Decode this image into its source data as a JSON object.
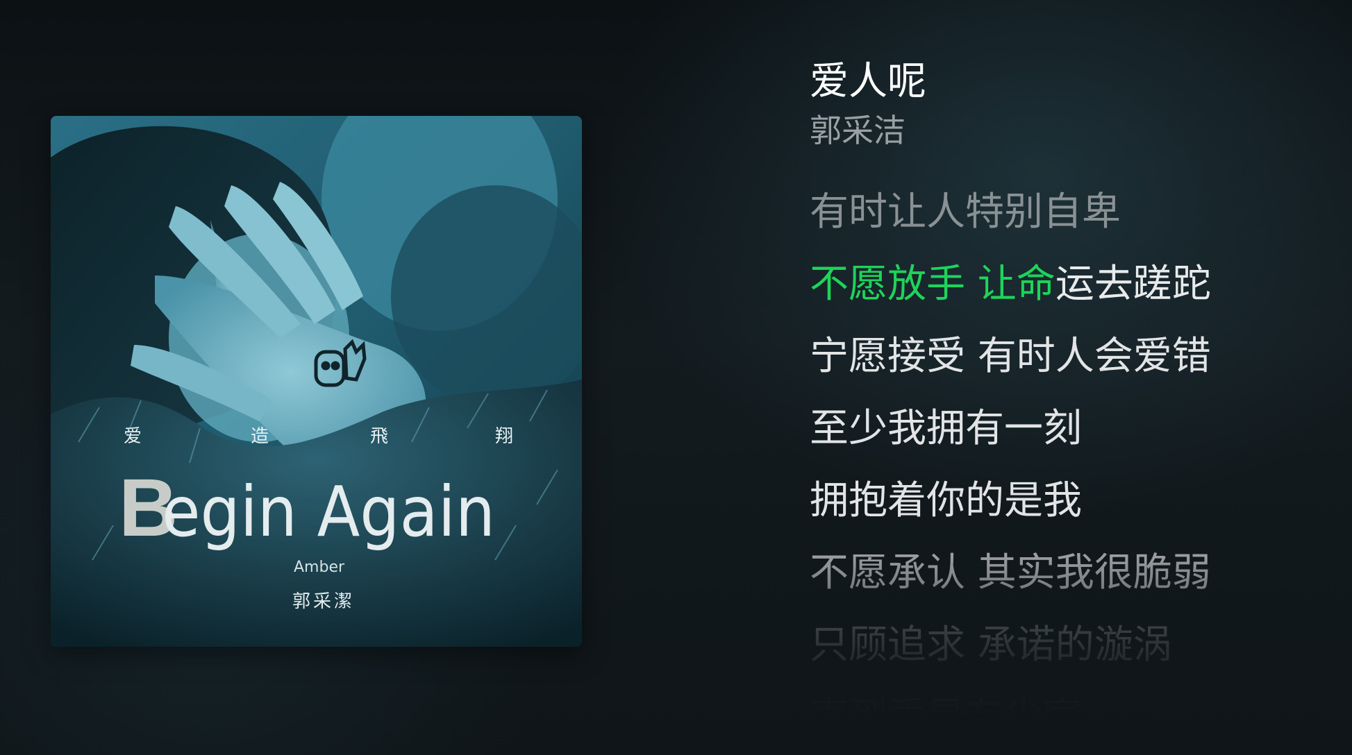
{
  "track": {
    "title": "爱人呢",
    "artist": "郭采洁"
  },
  "cover": {
    "top_chars": [
      "爱",
      "造",
      "飛",
      "翔"
    ],
    "album_title_initial": "B",
    "album_title_rest": "egin Again",
    "artist_en": "Amber",
    "artist_cn": "郭采潔"
  },
  "lyrics": {
    "previous": "有时让人特别自卑",
    "current_sung": "不愿放手 让命",
    "current_unsung": "运去蹉跎",
    "upcoming": [
      "宁愿接受 有时人会爱错",
      "至少我拥有一刻",
      "拥抱着你的是我",
      "不愿承认 其实我很脆弱",
      "只顾追求 承诺的漩涡",
      "直到爱是有尘室"
    ]
  },
  "colors": {
    "highlight": "#1ed45a",
    "title": "#ffffff",
    "artist": "#9aa1a4",
    "background": "#101518"
  }
}
